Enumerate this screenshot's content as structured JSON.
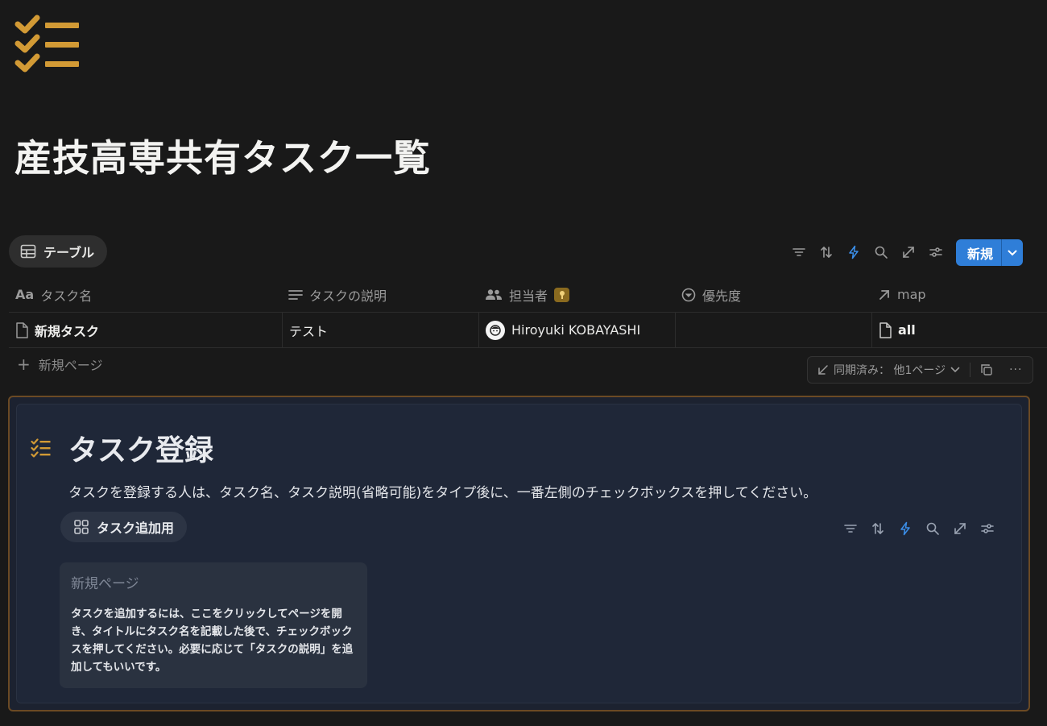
{
  "page": {
    "title": "産技高専共有タスク一覧",
    "icon": "checklist-icon",
    "icon_color": "#d29a35"
  },
  "view": {
    "tab_label": "テーブル",
    "tab_icon": "table-icon",
    "toolbar_icons": [
      "filter-icon",
      "sort-icon",
      "automation-icon",
      "search-icon",
      "expand-icon",
      "settings-icon"
    ],
    "new_button_label": "新規",
    "accent": "#2f7ed8"
  },
  "table": {
    "columns": [
      {
        "icon": "text-icon",
        "label": "タスク名"
      },
      {
        "icon": "lines-icon",
        "label": "タスクの説明"
      },
      {
        "icon": "people-icon",
        "label": "担当者"
      },
      {
        "icon": "status-icon",
        "label": "優先度"
      },
      {
        "icon": "arrow-icon",
        "label": "map"
      }
    ],
    "rows": [
      {
        "name": "新規タスク",
        "description": "テスト",
        "assignee": "Hiroyuki KOBAYASHI",
        "priority": "",
        "map": "all"
      }
    ],
    "add_page_label": "新規ページ"
  },
  "sync": {
    "status": "同期済み： 他1ページ"
  },
  "callout": {
    "title": "タスク登録",
    "text": "タスクを登録する人は、タスク名、タスク説明(省略可能)をタイプ後に、一番左側のチェックボックスを押してください。",
    "view_label": "タスク追加用",
    "card": {
      "title": "新規ページ",
      "body": "タスクを追加するには、ここをクリックしてページを開き、タイトルにタスク名を記載した後で、チェックボックスを押してください。必要に応じて「タスクの説明」を追加してもいいです。"
    }
  }
}
